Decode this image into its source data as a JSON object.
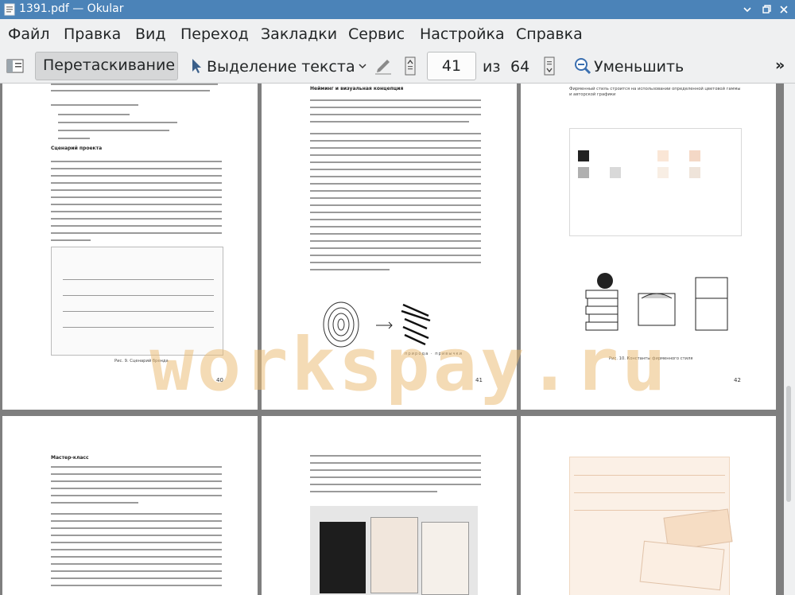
{
  "window": {
    "title": "1391.pdf — Okular"
  },
  "menu": [
    "Файл",
    "Правка",
    "Вид",
    "Переход",
    "Закладки",
    "Сервис",
    "Настройка",
    "Справка"
  ],
  "toolbar": {
    "drag_label": "Перетаскивание",
    "select_label": "Выделение текста",
    "current_page": "41",
    "of_label": "из",
    "total_pages": "64",
    "zoom_out_label": "Уменьшить"
  },
  "pages": {
    "p40": {
      "number": "40",
      "heading_scenario": "Сценарий проекта",
      "caption": "Рис. 9. Сценарий бренда"
    },
    "p41": {
      "number": "41",
      "heading": "Нейминг и визуальная концепция",
      "figure_caption": "природа · привычки"
    },
    "p42": {
      "number": "42",
      "intro": "Фирменный стиль строится на использовании определенной цветовой гаммы и авторской графики",
      "caption": "Рис. 10. Константы фирменного стиля"
    },
    "p43": {
      "heading": "Мастер-класс"
    }
  },
  "watermark": "workspay.ru",
  "colors": {
    "titlebar": "#4b83b8",
    "accent_peach": "#f6ddc4"
  }
}
